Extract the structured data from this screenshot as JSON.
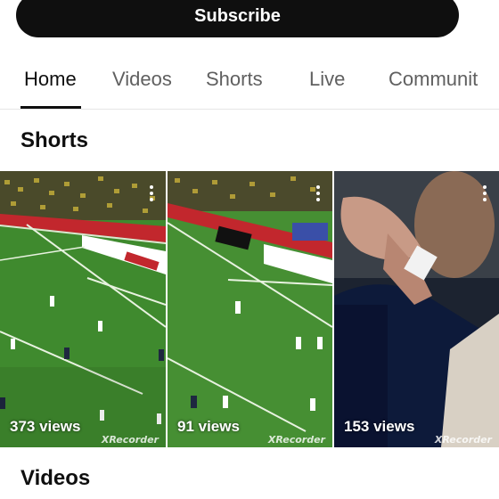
{
  "subscribe_label": "Subscribe",
  "tabs": [
    {
      "label": "Home",
      "active": true
    },
    {
      "label": "Videos",
      "active": false
    },
    {
      "label": "Shorts",
      "active": false
    },
    {
      "label": "Live",
      "active": false
    },
    {
      "label": "Communit",
      "active": false
    }
  ],
  "sections": {
    "shorts_title": "Shorts",
    "videos_title": "Videos"
  },
  "shorts": [
    {
      "views": "373 views",
      "watermark": "XRecorder"
    },
    {
      "views": "91 views",
      "watermark": "XRecorder"
    },
    {
      "views": "153 views",
      "watermark": "XRecorder"
    }
  ],
  "icons": {
    "more": "kebab-vertical-icon"
  },
  "colors": {
    "button_bg": "#0f0f0f",
    "pitch_green": "#3f8a2e",
    "tab_inactive": "#606060"
  }
}
